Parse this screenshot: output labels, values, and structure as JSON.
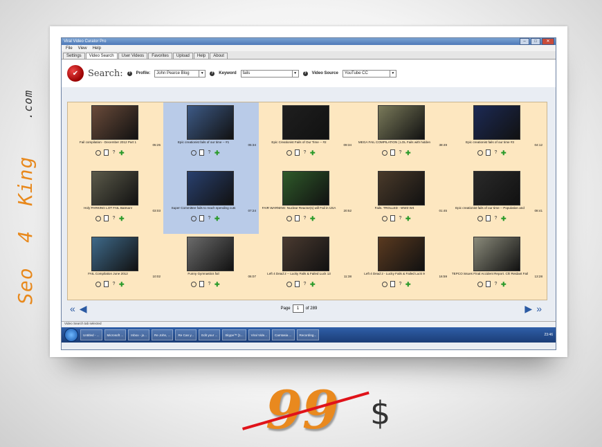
{
  "brand": {
    "name_1": "Seo",
    "name_2": "4",
    "name_3": "King",
    "tld": ".com"
  },
  "window": {
    "title": "Viral Video Curator Pro",
    "menu": [
      "File",
      "View",
      "Help"
    ],
    "tabs": [
      "Settings",
      "Video Search",
      "User Videos",
      "Favorites",
      "Upload",
      "Help",
      "About"
    ],
    "active_tab": "Video Search"
  },
  "search": {
    "label": "Search:",
    "profile_label": "Profile:",
    "profile_value": "John Pearce Blog",
    "keyword_label": "Keyword",
    "keyword_value": "fails",
    "source_label": "Video Source",
    "source_value": "YouTube CC"
  },
  "videos": [
    {
      "title": "Fail compilation - December 2012 Part 1",
      "duration": "05:25"
    },
    {
      "title": "Epic creationist fails of our time -- #1",
      "duration": "05:34"
    },
    {
      "title": "Epic Creationist Fails of Our Time -- #2",
      "duration": "09:34"
    },
    {
      "title": "MEGA FAIL COMPILATION | LOL Fails with hidden",
      "duration": "38:49"
    },
    {
      "title": "Epic creationist fails of our time #3",
      "duration": "04:12"
    },
    {
      "title": "Holy PARKING LOT FAIL Batman!",
      "duration": "03:03"
    },
    {
      "title": "Super Committee fails to reach spending cuts",
      "duration": "07:24"
    },
    {
      "title": "FAIR WARNING: Nuclear Reactor(s) will Fail in USA",
      "duration": "20:52"
    },
    {
      "title": "Fails. TROLLED - WW3 W4",
      "duration": "01:45"
    },
    {
      "title": "Epic creationist fails of our time -- Population and",
      "duration": "08:41"
    },
    {
      "title": "FAIL Compilation June 2012",
      "duration": "10:02"
    },
    {
      "title": "Funny Gymnastics fail",
      "duration": "06:07"
    },
    {
      "title": "Left 4 Dead 2 -- Lucky Fails & Failed Luck 13",
      "duration": "11:38"
    },
    {
      "title": "Left 4 Dead 2 - Lucky Fails & Failed Luck 9",
      "duration": "16:59"
    },
    {
      "title": "TEPCO issues Final Accident Report. Chl Reidant Fail",
      "duration": "13:28"
    }
  ],
  "pager": {
    "page_label": "Page",
    "page_value": "1",
    "total": "of 289"
  },
  "status": "Video Search tab selected",
  "taskbar": {
    "items": [
      "Untitled - ...",
      "Microsoft ...",
      "Inbox - jo...",
      "Re John, ...",
      "Re Can y...",
      "Edit your ...",
      "Skype™ [1...",
      "Viral Vide...",
      "Camtasia ...",
      "Recording..."
    ],
    "time": "23:46"
  },
  "price": {
    "value": "99",
    "currency": "$"
  },
  "colors": {
    "accent": "#e9891e",
    "strike": "#e0131a",
    "grid_bg": "#fde7c0"
  }
}
